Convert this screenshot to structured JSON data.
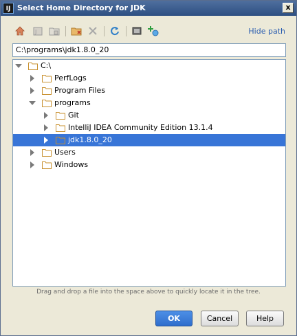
{
  "window": {
    "title": "Select Home Directory for JDK",
    "app_icon": "intellij-icon",
    "close_label": "x"
  },
  "toolbar": {
    "buttons": [
      {
        "name": "home-directory-icon"
      },
      {
        "name": "project-directory-icon"
      },
      {
        "name": "module-directory-icon"
      },
      {
        "name": "new-folder-icon"
      },
      {
        "name": "delete-icon"
      },
      {
        "name": "refresh-icon"
      },
      {
        "name": "show-hidden-files-icon"
      },
      {
        "name": "add-network-icon"
      }
    ],
    "hide_path_label": "Hide path"
  },
  "path_field": {
    "value": "C:\\programs\\jdk1.8.0_20"
  },
  "tree": {
    "nodes": [
      {
        "label": "C:\\",
        "expanded": true,
        "selected": false
      },
      {
        "label": "PerfLogs",
        "expanded": false,
        "selected": false
      },
      {
        "label": "Program Files",
        "expanded": false,
        "selected": false
      },
      {
        "label": "programs",
        "expanded": true,
        "selected": false
      },
      {
        "label": "Git",
        "expanded": false,
        "selected": false
      },
      {
        "label": "IntelliJ IDEA Community Edition 13.1.4",
        "expanded": false,
        "selected": false
      },
      {
        "label": "jdk1.8.0_20",
        "expanded": false,
        "selected": true
      },
      {
        "label": "Users",
        "expanded": false,
        "selected": false
      },
      {
        "label": "Windows",
        "expanded": false,
        "selected": false
      }
    ]
  },
  "hint": "Drag and drop a file into the space above to quickly locate it in the tree.",
  "buttons": {
    "ok": "OK",
    "cancel": "Cancel",
    "help": "Help"
  },
  "colors": {
    "selection": "#3875d7",
    "folder": "#c8902e",
    "link": "#2a5db0"
  }
}
